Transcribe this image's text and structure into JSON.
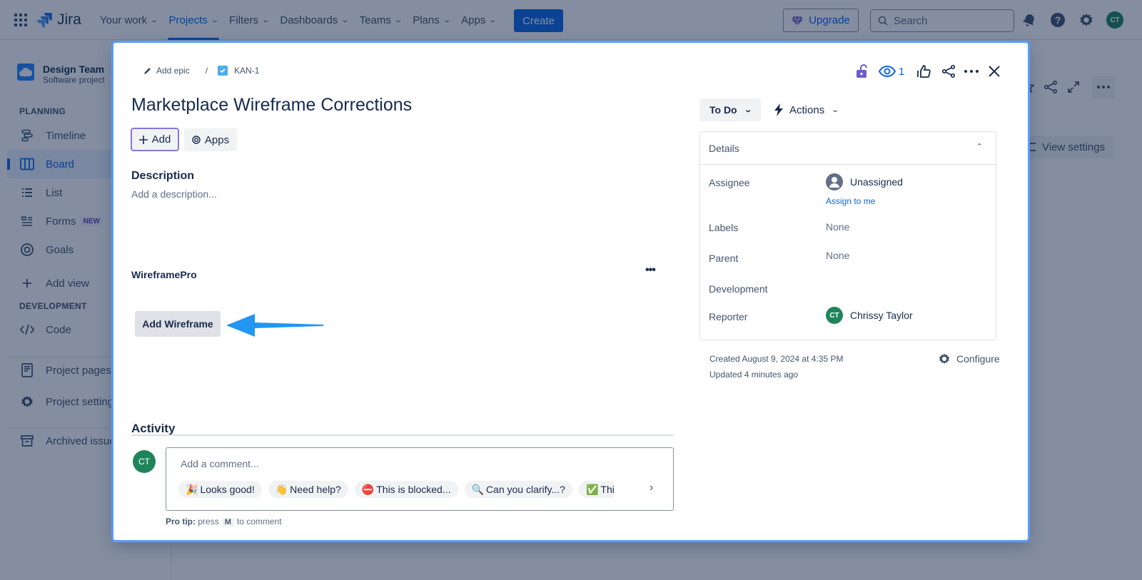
{
  "topnav": {
    "product": "Jira",
    "items": [
      {
        "label": "Your work",
        "active": false
      },
      {
        "label": "Projects",
        "active": true
      },
      {
        "label": "Filters",
        "active": false
      },
      {
        "label": "Dashboards",
        "active": false
      },
      {
        "label": "Teams",
        "active": false
      },
      {
        "label": "Plans",
        "active": false
      },
      {
        "label": "Apps",
        "active": false
      }
    ],
    "create_label": "Create",
    "upgrade_label": "Upgrade",
    "search_placeholder": "Search",
    "user_initials": "CT",
    "icons": [
      "app-switcher-icon",
      "notifications-icon",
      "help-icon",
      "settings-icon"
    ]
  },
  "sidebar": {
    "project_name": "Design Team",
    "project_type": "Software project",
    "planning_heading": "PLANNING",
    "planning_items": [
      {
        "label": "Timeline",
        "icon": "timeline-icon"
      },
      {
        "label": "Board",
        "icon": "board-icon",
        "active": true
      },
      {
        "label": "List",
        "icon": "list-icon"
      },
      {
        "label": "Forms",
        "icon": "forms-icon",
        "badge": "NEW"
      },
      {
        "label": "Goals",
        "icon": "goals-icon"
      }
    ],
    "add_view_label": "Add view",
    "development_heading": "DEVELOPMENT",
    "development_items": [
      {
        "label": "Code",
        "icon": "code-icon"
      }
    ],
    "footer_items": [
      {
        "label": "Project pages",
        "icon": "page-icon"
      },
      {
        "label": "Project settings",
        "icon": "gear-icon"
      },
      {
        "label": "Archived issues",
        "icon": "archive-icon"
      }
    ]
  },
  "board": {
    "view_settings_label": "View settings"
  },
  "modal": {
    "breadcrumb": {
      "add_epic": "Add epic",
      "separator": "/",
      "issue_key": "KAN-1"
    },
    "title": "Marketplace Wireframe Corrections",
    "add_button": "Add",
    "apps_button": "Apps",
    "description_heading": "Description",
    "description_placeholder": "Add a description...",
    "app_panel": {
      "title": "WireframePro",
      "more": "•••",
      "button": "Add Wireframe"
    },
    "header_actions": {
      "watch_count": "1"
    },
    "status": "To Do",
    "actions_label": "Actions",
    "details": {
      "heading": "Details",
      "fields": {
        "assignee_label": "Assignee",
        "assignee_value": "Unassigned",
        "assign_to_me": "Assign to me",
        "labels_label": "Labels",
        "labels_value": "None",
        "parent_label": "Parent",
        "parent_value": "None",
        "development_label": "Development",
        "reporter_label": "Reporter",
        "reporter_value": "Chrissy Taylor",
        "reporter_initials": "CT"
      }
    },
    "created": "Created August 9, 2024 at 4:35 PM",
    "updated": "Updated 4 minutes ago",
    "configure_label": "Configure",
    "activity": {
      "heading": "Activity",
      "user_initials": "CT",
      "comment_placeholder": "Add a comment...",
      "quick_replies": [
        {
          "emoji": "🎉",
          "label": "Looks good!"
        },
        {
          "emoji": "👋",
          "label": "Need help?"
        },
        {
          "emoji": "⛔",
          "label": "This is blocked..."
        },
        {
          "emoji": "🔍",
          "label": "Can you clarify...?"
        },
        {
          "emoji": "✅",
          "label": "This is on track"
        }
      ],
      "protip_bold": "Pro tip:",
      "protip_pre": "press",
      "protip_key": "M",
      "protip_post": "to comment"
    }
  },
  "colors": {
    "accent": "#0c66e4",
    "create_button": "#0c66e4",
    "avatar_green": "#1f845a",
    "annotation_arrow": "#2196f3",
    "focus_ring": "#579dff",
    "add_button_border": "#8777d9"
  }
}
